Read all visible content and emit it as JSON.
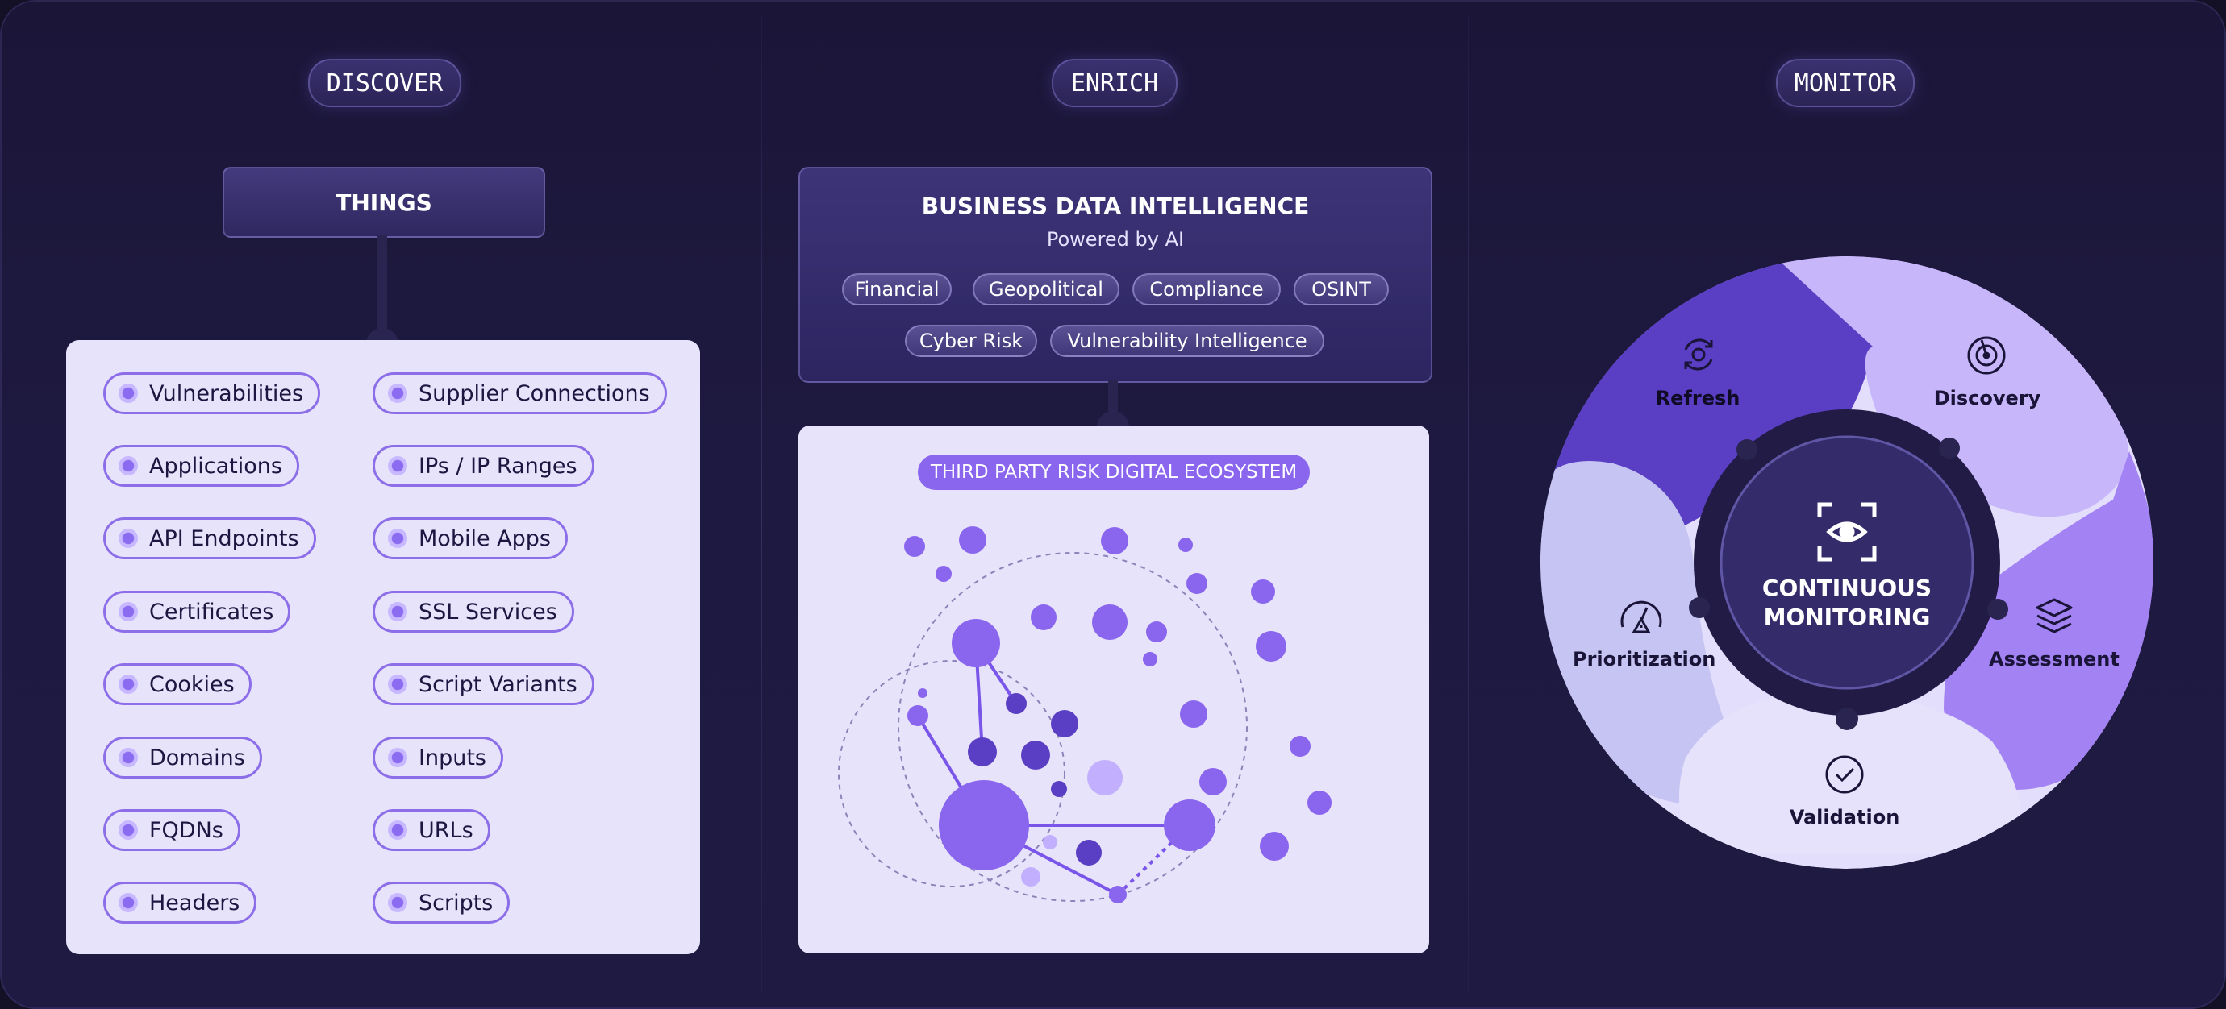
{
  "sections": {
    "discover": "DISCOVER",
    "enrich": "ENRICH",
    "monitor": "MONITOR"
  },
  "discover": {
    "header": "THINGS",
    "items_left": [
      "Vulnerabilities",
      "Applications",
      "API Endpoints",
      "Certificates",
      "Cookies",
      "Domains",
      "FQDNs",
      "Headers"
    ],
    "items_right": [
      "Supplier Connections",
      "IPs / IP Ranges",
      "Mobile Apps",
      "SSL Services",
      "Script Variants",
      "Inputs",
      "URLs",
      "Scripts"
    ]
  },
  "enrich": {
    "title": "BUSINESS DATA INTELLIGENCE",
    "subtitle": "Powered by AI",
    "tags": [
      "Financial",
      "Geopolitical",
      "Compliance",
      "OSINT",
      "Cyber Risk",
      "Vulnerability Intelligence"
    ],
    "ecosystem_label": "THIRD PARTY RISK DIGITAL ECOSYSTEM"
  },
  "monitor": {
    "center_line1": "CONTINUOUS",
    "center_line2": "MONITORING",
    "stages": {
      "refresh": "Refresh",
      "discovery": "Discovery",
      "assessment": "Assessment",
      "validation": "Validation",
      "prioritization": "Prioritization"
    }
  },
  "icons": [
    "refresh-icon",
    "radar-icon",
    "layers-icon",
    "check-circle-icon",
    "gauge-icon",
    "eye-scan-icon",
    "bullet-icon"
  ],
  "colors": {
    "background": "#1e1940",
    "panel": "#e7e3fb",
    "accent": "#8a65ee",
    "chip_border": "#8c6fe8",
    "node_dark": "#5a3fc4",
    "node_light": "#c2b0ff"
  }
}
